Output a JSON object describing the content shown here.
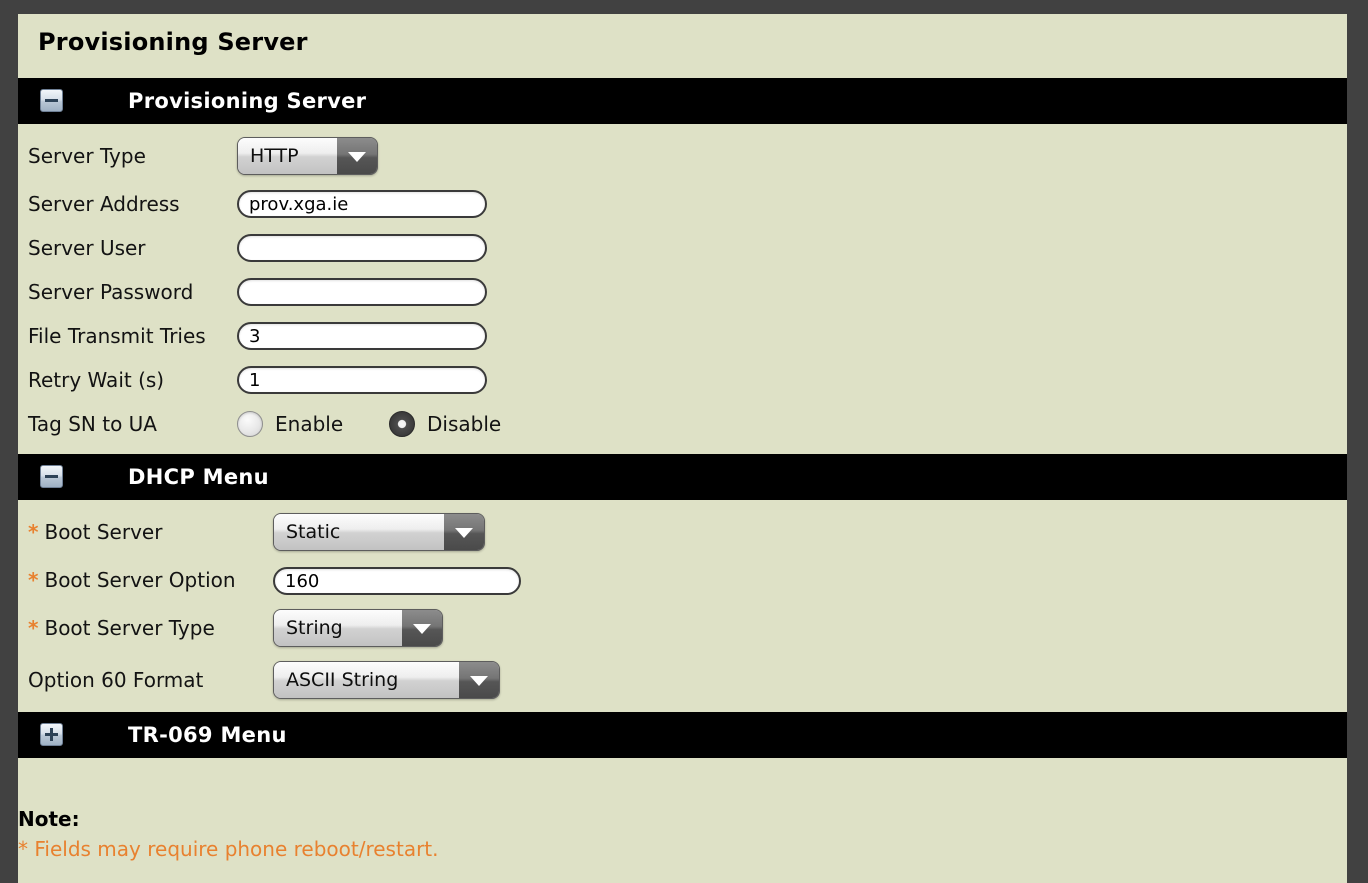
{
  "page": {
    "title": "Provisioning Server"
  },
  "sections": [
    {
      "id": "provisioning-server",
      "title": "Provisioning Server",
      "toggle_icon": "minus-square-icon",
      "expanded": true
    },
    {
      "id": "dhcp-menu",
      "title": "DHCP Menu",
      "toggle_icon": "minus-square-icon",
      "expanded": true
    },
    {
      "id": "tr069-menu",
      "title": "TR-069 Menu",
      "toggle_icon": "plus-square-icon",
      "expanded": false
    }
  ],
  "provisioning": {
    "server_type": {
      "label": "Server Type",
      "value": "HTTP",
      "options": [
        "HTTP"
      ]
    },
    "server_address": {
      "label": "Server Address",
      "value": "prov.xga.ie",
      "placeholder": ""
    },
    "server_user": {
      "label": "Server User",
      "value": "",
      "placeholder": ""
    },
    "server_password": {
      "label": "Server Password",
      "value": "",
      "placeholder": ""
    },
    "file_transmit_tries": {
      "label": "File Transmit Tries",
      "value": "3",
      "placeholder": ""
    },
    "retry_wait": {
      "label": "Retry Wait (s)",
      "value": "1",
      "placeholder": ""
    },
    "tag_sn_to_ua": {
      "label": "Tag SN to UA",
      "enable_label": "Enable",
      "disable_label": "Disable",
      "selected": "Disable"
    }
  },
  "dhcp": {
    "boot_server": {
      "label": "Boot Server",
      "required_marker": "*",
      "value": "Static",
      "options": [
        "Static"
      ]
    },
    "boot_server_option": {
      "label": "Boot Server Option",
      "required_marker": "*",
      "value": "160",
      "placeholder": ""
    },
    "boot_server_type": {
      "label": "Boot Server Type",
      "required_marker": "*",
      "value": "String",
      "options": [
        "String"
      ]
    },
    "option_60_format": {
      "label": "Option 60 Format",
      "value": "ASCII String",
      "options": [
        "ASCII String"
      ]
    }
  },
  "note": {
    "heading": "Note:",
    "text": "* Fields may require phone reboot/restart."
  },
  "colors": {
    "page_background": "#dee1c6",
    "frame": "#414141",
    "section_bar": "#000000",
    "accent_orange": "#e8812f",
    "text": "#131313"
  }
}
